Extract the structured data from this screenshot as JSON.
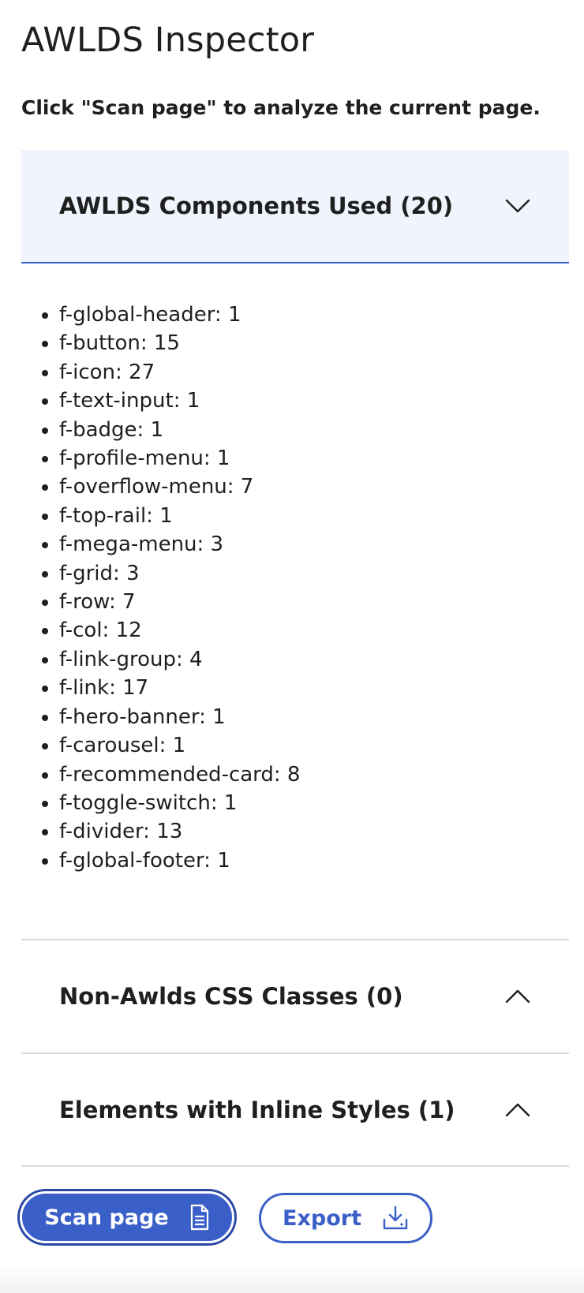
{
  "app": {
    "title": "AWLDS Inspector",
    "hint": "Click \"Scan page\" to analyze the current page."
  },
  "sections": [
    {
      "title": "AWLDS Components Used (20)",
      "expanded": true,
      "chevron": "chevron-down-icon"
    },
    {
      "title": "Non-Awlds CSS Classes (0)",
      "expanded": false,
      "chevron": "chevron-up-icon"
    },
    {
      "title": "Elements with Inline Styles (1)",
      "expanded": false,
      "chevron": "chevron-up-icon"
    }
  ],
  "components": [
    "f-global-header: 1",
    "f-button: 15",
    "f-icon: 27",
    "f-text-input: 1",
    "f-badge: 1",
    "f-profile-menu: 1",
    "f-overflow-menu: 7",
    "f-top-rail: 1",
    "f-mega-menu: 3",
    "f-grid: 3",
    "f-row: 7",
    "f-col: 12",
    "f-link-group: 4",
    "f-link: 17",
    "f-hero-banner: 1",
    "f-carousel: 1",
    "f-recommended-card: 8",
    "f-toggle-switch: 1",
    "f-divider: 13",
    "f-global-footer: 1"
  ],
  "actions": {
    "scan_label": "Scan page",
    "scan_icon": "document-icon",
    "export_label": "Export",
    "export_icon": "download-icon"
  },
  "colors": {
    "accent": "#3b5fc8",
    "header_bg": "#f0f5fd",
    "divider": "#d9dadc",
    "text": "#1f1f1f"
  }
}
